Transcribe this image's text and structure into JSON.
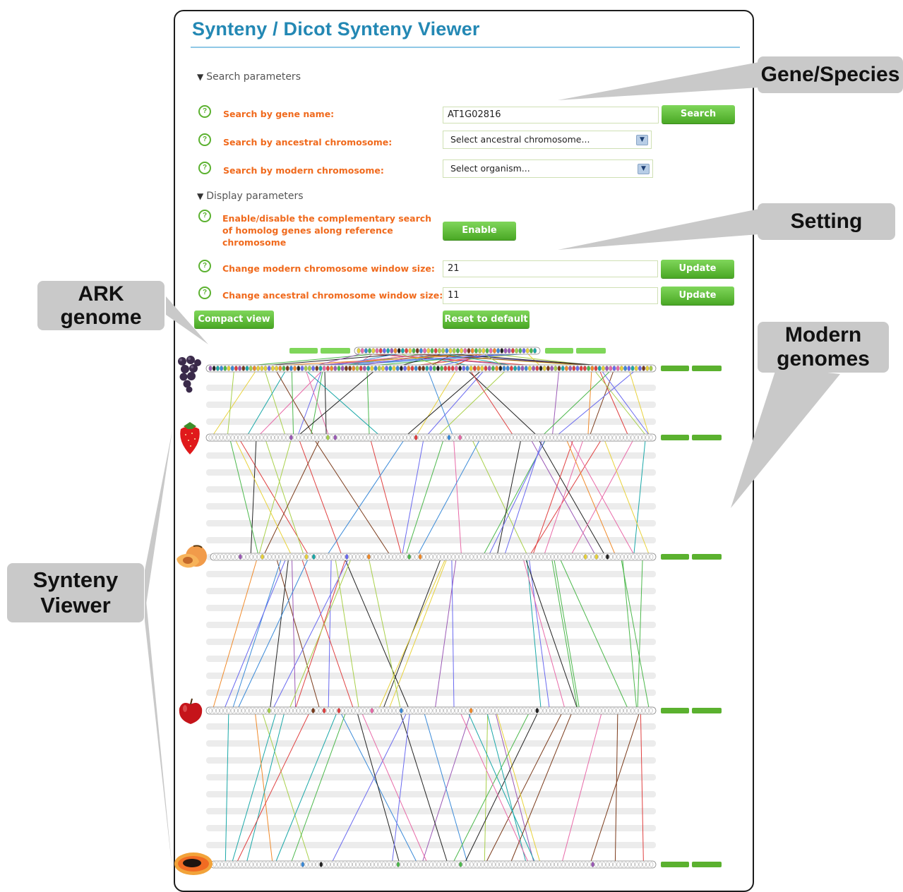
{
  "header": {
    "title": "Synteny / Dicot Synteny Viewer"
  },
  "search_params": {
    "header": "Search parameters",
    "gene_label": "Search by gene name:",
    "gene_value": "AT1G02816",
    "search_btn": "Search",
    "ancestral_label": "Search by ancestral chromosome:",
    "ancestral_value": "Select ancestral chromosome...",
    "modern_label": "Search by modern chromosome:",
    "modern_value": "Select organism..."
  },
  "display_params": {
    "header": "Display parameters",
    "complementary_label": "Enable/disable the complementary search of homolog genes along reference chromosome",
    "enable_btn": "Enable",
    "modern_window_label": "Change modern chromosome window size:",
    "modern_window_value": "21",
    "update_btn": "Update",
    "ancestral_window_label": "Change ancestral chromosome window size:",
    "ancestral_window_value": "11"
  },
  "buttons": {
    "compact_view": "Compact view",
    "reset_default": "Reset to default"
  },
  "callouts": {
    "gene_species": "Gene/Species",
    "setting": "Setting",
    "ark_genome": "ARK genome",
    "modern_genomes": "Modern genomes",
    "synteny_viewer": "Synteny Viewer"
  },
  "species": [
    "grape",
    "strawberry",
    "peach",
    "apple",
    "papaya"
  ],
  "colors": {
    "title": "#2388b4",
    "label_orange": "#f06a1d",
    "button_green": "#5bb12f",
    "callout_gray": "#c9c9c9"
  }
}
